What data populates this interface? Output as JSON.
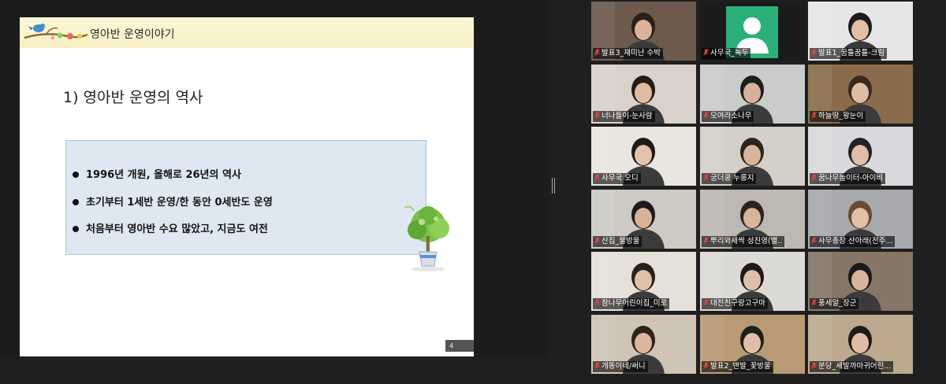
{
  "slide": {
    "title": "영아반 운영이야기",
    "heading": "1) 영아반 운영의 역사",
    "bullets": [
      "1996년 개원, 올해로 26년의 역사",
      "초기부터 1세반 운영/한 동안 0세반도 운영",
      "처음부터 영아반 수요 많았고, 지금도 여전"
    ],
    "page_number": "4"
  },
  "participants": [
    {
      "name": "발표3_재미난 수박",
      "bg": "#6e5a4c",
      "skin": "#d9b39b",
      "hair": "#2a1f1a"
    },
    {
      "name": "사무국_녹두",
      "bg": "#1b1b1b",
      "avatar": true
    },
    {
      "name": "발표1_꿈틀꿈틀-크림",
      "bg": "#e6e6e8",
      "skin": "#e2bfa7",
      "hair": "#1c1c1c"
    },
    {
      "name": "너나들이-눈사람",
      "bg": "#d8d2ca",
      "skin": "#e0bba3",
      "hair": "#251c16"
    },
    {
      "name": "모여라소나무",
      "bg": "#c9ccc9",
      "skin": "#d6b099",
      "hair": "#1d1d1d"
    },
    {
      "name": "하늘땅_왕눈이",
      "bg": "#8a6c4d",
      "skin": "#e0bca4",
      "hair": "#3a2a1f"
    },
    {
      "name": "사무국 오디",
      "bg": "#e9e5df",
      "skin": "#e3c2ab",
      "hair": "#1e1a18"
    },
    {
      "name": "궁더쿵 누룽지",
      "bg": "#d4cfc8",
      "skin": "#d9b49c",
      "hair": "#2b2420"
    },
    {
      "name": "꿈나무놀이터-아이비",
      "bg": "#d9dadd",
      "skin": "#e0bea7",
      "hair": "#232323"
    },
    {
      "name": "산집_물방울",
      "bg": "#cdcac4",
      "skin": "#d8b197",
      "hair": "#1b1b1b"
    },
    {
      "name": "뿌리와새싹 성진영(별..",
      "bg": "#bdb8b2",
      "skin": "#d9b49c",
      "hair": "#2a2320"
    },
    {
      "name": "사무총장 산아래(전주...",
      "bg": "#a7a9ac",
      "skin": "#e1bfa8",
      "hair": "#6b4a32"
    },
    {
      "name": "참나무어린이집_미로",
      "bg": "#e5e1da",
      "skin": "#e2c1a9",
      "hair": "#2a201a"
    },
    {
      "name": "대전친구랑고구마",
      "bg": "#dcdad6",
      "skin": "#e0bfa8",
      "hair": "#1f1a18"
    },
    {
      "name": "풍세알_장군",
      "bg": "#857667",
      "skin": "#d9b49c",
      "hair": "#1a1a1a"
    },
    {
      "name": "개똥이네/써니",
      "bg": "#cfc4b5",
      "skin": "#dcb69e",
      "hair": "#2d231d"
    },
    {
      "name": "발표2_맨발_꽃방울",
      "bg": "#b99a74",
      "skin": "#e1bea6",
      "hair": "#1e1e1e"
    },
    {
      "name": "분당_세발까마귀어린...",
      "bg": "#bca98f",
      "skin": "#dfbca5",
      "hair": "#1e1a17"
    }
  ],
  "colors": {
    "active_speaker": "#c8d84c",
    "mic_off": "#e14646",
    "avatar_bg": "#2bb07a"
  }
}
